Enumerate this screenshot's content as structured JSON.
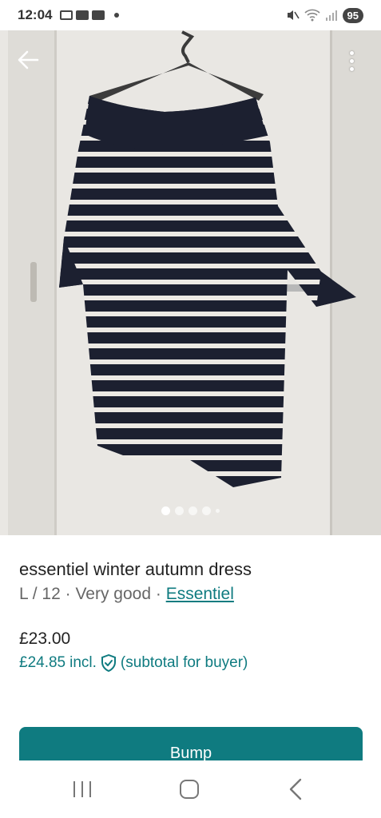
{
  "status_bar": {
    "time": "12:04",
    "battery": "95"
  },
  "photo": {
    "dots_total": 5,
    "active_index": 0
  },
  "listing": {
    "title": "essentiel winter autumn dress",
    "size": "L / 12",
    "separator1": " · ",
    "condition": "Very good",
    "separator2": " · ",
    "brand": "Essentiel",
    "price": "£23.00",
    "price_incl_amount": "£24.85",
    "price_incl_label": "incl.",
    "price_incl_note": "(subtotal for buyer)"
  },
  "actions": {
    "bump_label": "Bump"
  },
  "colors": {
    "accent": "#0f7b80"
  }
}
